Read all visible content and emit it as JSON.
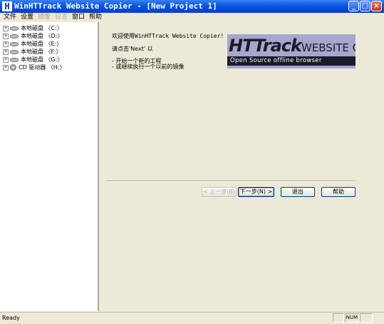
{
  "window": {
    "app_icon_glyph": "H",
    "title": "WinHTTrack Website Copier - [New Project 1]",
    "controls": {
      "minimize": "_",
      "maximize": "□",
      "close": "×"
    }
  },
  "menu": {
    "items": [
      {
        "label": "文件",
        "enabled": true
      },
      {
        "label": "设置",
        "enabled": true
      },
      {
        "label": "镜像",
        "enabled": false
      },
      {
        "label": "日志",
        "enabled": false
      },
      {
        "label": "窗口",
        "enabled": true
      },
      {
        "label": "帮助",
        "enabled": true
      }
    ]
  },
  "tree": {
    "expander": "+",
    "items": [
      {
        "label": "本地磁盘 〈C:〉",
        "icon": "hard-drive-icon"
      },
      {
        "label": "本地磁盘 〈D:〉",
        "icon": "hard-drive-icon"
      },
      {
        "label": "本地磁盘 〈E:〉",
        "icon": "hard-drive-icon"
      },
      {
        "label": "本地磁盘 〈F:〉",
        "icon": "hard-drive-icon"
      },
      {
        "label": "本地磁盘 〈G:〉",
        "icon": "hard-drive-icon"
      },
      {
        "label": "CD 驱动器 〈H:〉",
        "icon": "cd-drive-icon"
      }
    ]
  },
  "wizard": {
    "welcome": "欢迎使用WinHTTrack Website Copier!",
    "instruction": "请点击'Next' 以",
    "options": [
      "- 开始一个新的工程",
      "- 或继续执行一个以前的镜像"
    ],
    "logo": {
      "big": "HTTrack",
      "small": "WEBSITE COPIER",
      "tagline": "Open Source offline browser"
    },
    "buttons": {
      "back": "< 上一步(B)",
      "next": "下一步(N) >",
      "exit": "退出",
      "help": "帮助"
    }
  },
  "status": {
    "text": "Ready",
    "panel_middle": "",
    "panel_right": "NUM",
    "panel_far_right": ""
  }
}
